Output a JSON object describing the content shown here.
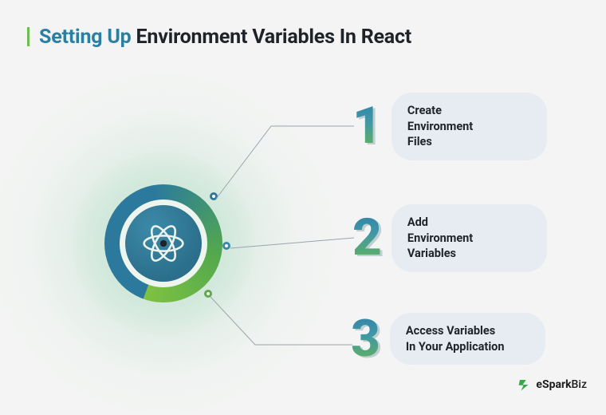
{
  "title": {
    "accent": "Setting Up",
    "rest": "Environment Variables In React"
  },
  "center_icon": "react-logo-icon",
  "steps": [
    {
      "n": "1",
      "label": "Create\nEnvironment\nFiles"
    },
    {
      "n": "2",
      "label": "Add\nEnvironment\nVariables"
    },
    {
      "n": "3",
      "label": "Access Variables\nIn Your Application"
    }
  ],
  "brand": {
    "name": "eSpark",
    "suffix": "Biz"
  },
  "colors": {
    "accent_blue": "#2a7fa3",
    "accent_green": "#6bbf4b",
    "pill_bg": "#e7ebf2"
  }
}
